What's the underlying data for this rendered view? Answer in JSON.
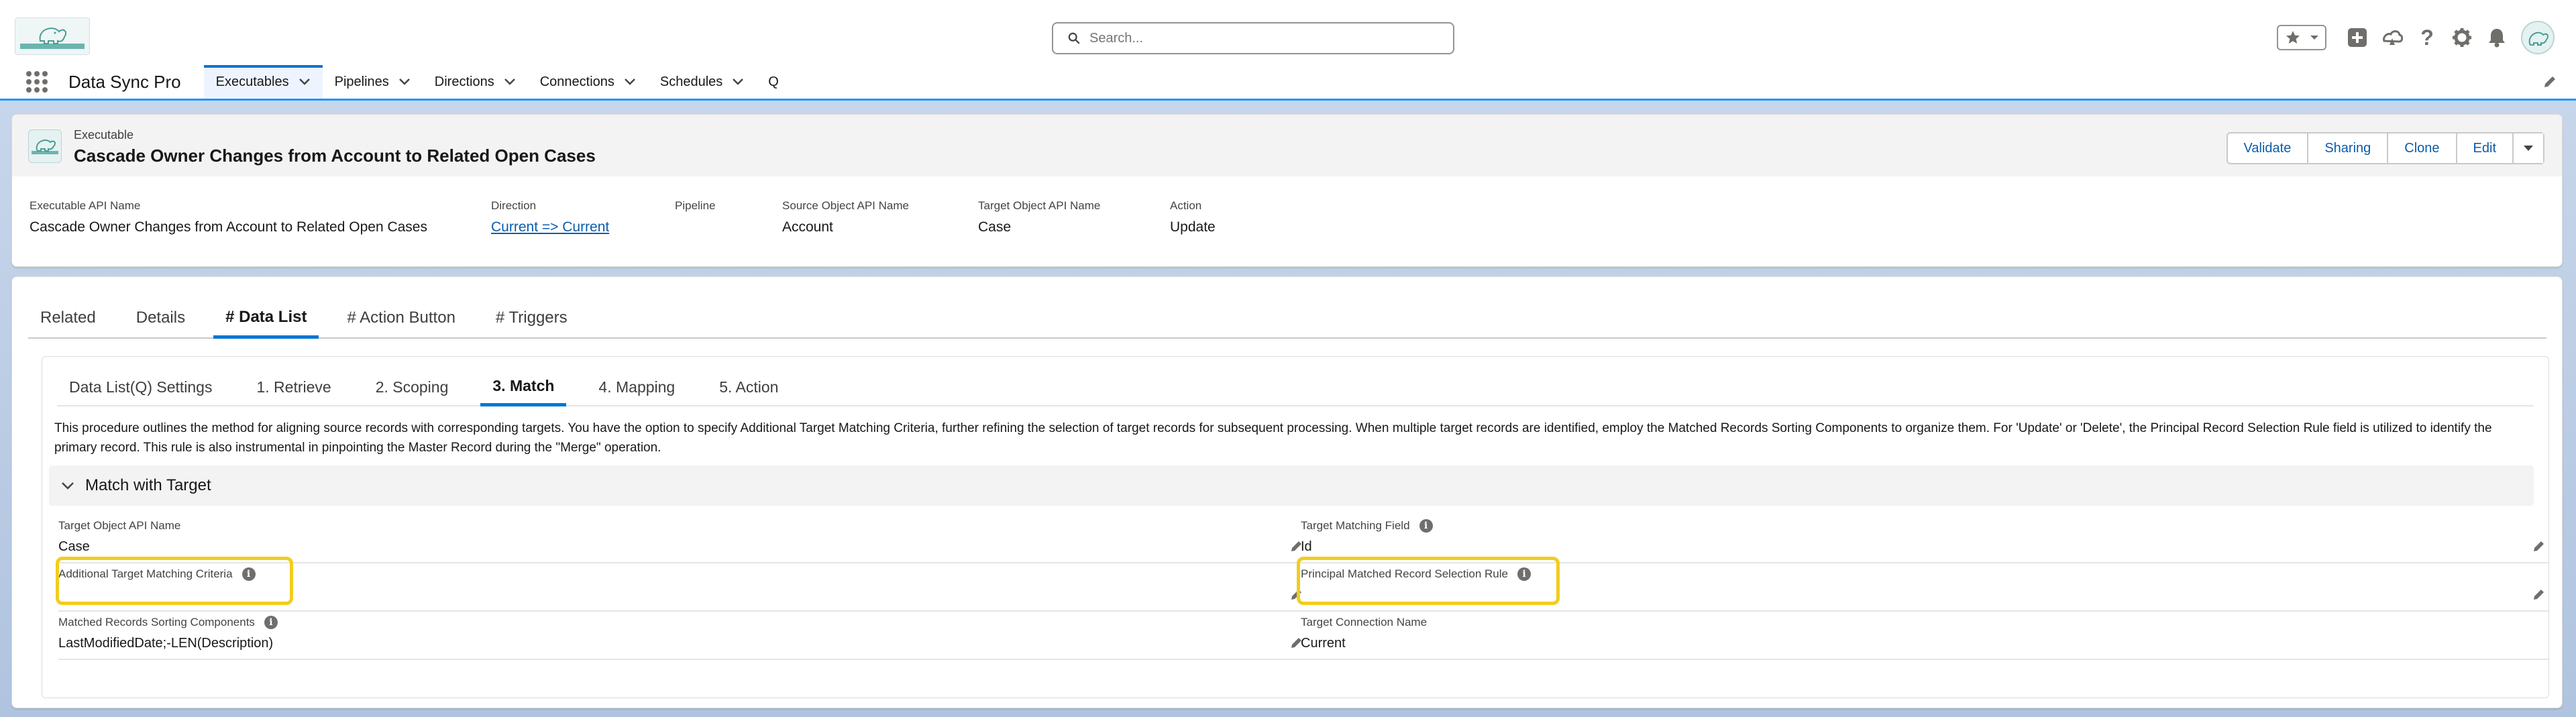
{
  "global": {
    "search_placeholder": "Search...",
    "help_glyph": "?"
  },
  "nav": {
    "app_name": "Data Sync Pro",
    "items": [
      {
        "label": "Executables",
        "active": true,
        "has_menu": true
      },
      {
        "label": "Pipelines",
        "has_menu": true
      },
      {
        "label": "Directions",
        "has_menu": true
      },
      {
        "label": "Connections",
        "has_menu": true
      },
      {
        "label": "Schedules",
        "has_menu": true
      },
      {
        "label": "Q",
        "has_menu": false
      }
    ]
  },
  "record": {
    "type": "Executable",
    "title": "Cascade Owner Changes from Account to Related Open Cases",
    "actions": [
      "Validate",
      "Sharing",
      "Clone",
      "Edit"
    ],
    "highlights": [
      {
        "label": "Executable API Name",
        "value": "Cascade Owner Changes from Account to Related Open Cases"
      },
      {
        "label": "Direction",
        "value": "Current => Current",
        "link": true
      },
      {
        "label": "Pipeline",
        "value": ""
      },
      {
        "label": "Source Object API Name",
        "value": "Account"
      },
      {
        "label": "Target Object API Name",
        "value": "Case"
      },
      {
        "label": "Action",
        "value": "Update"
      }
    ]
  },
  "tabs": [
    "Related",
    "Details",
    "# Data List",
    "# Action Button",
    "# Triggers"
  ],
  "active_tab": "# Data List",
  "subtabs": [
    "Data List(Q) Settings",
    "1. Retrieve",
    "2. Scoping",
    "3. Match",
    "4. Mapping",
    "5. Action"
  ],
  "active_subtab": "3. Match",
  "match": {
    "description": "This procedure outlines the method for aligning source records with corresponding targets. You have the option to specify Additional Target Matching Criteria, further refining the selection of target records for subsequent processing. When multiple target records are identified, employ the Matched Records Sorting Components to organize them. For 'Update' or 'Delete', the Principal Record Selection Rule field is utilized to identify the primary record. This rule is also instrumental in pinpointing the Master Record during the \"Merge\" operation.",
    "section_title": "Match with Target",
    "fields": {
      "target_object_api_name": {
        "label": "Target Object API Name",
        "value": "Case"
      },
      "target_matching_field": {
        "label": "Target Matching Field",
        "value": "Id"
      },
      "additional_target_matching_criteria": {
        "label": "Additional Target Matching Criteria",
        "value": ""
      },
      "principal_matched_record_selection_rule": {
        "label": "Principal Matched Record Selection Rule",
        "value": ""
      },
      "matched_records_sorting_components": {
        "label": "Matched Records Sorting Components",
        "value": "LastModifiedDate;-LEN(Description)"
      },
      "target_connection_name": {
        "label": "Target Connection Name",
        "value": "Current"
      }
    }
  },
  "colors": {
    "brand_blue": "#0176d3",
    "link_blue": "#0b5cab",
    "highlight_yellow": "#f2cd1d",
    "page_background": "#b0c4df"
  }
}
